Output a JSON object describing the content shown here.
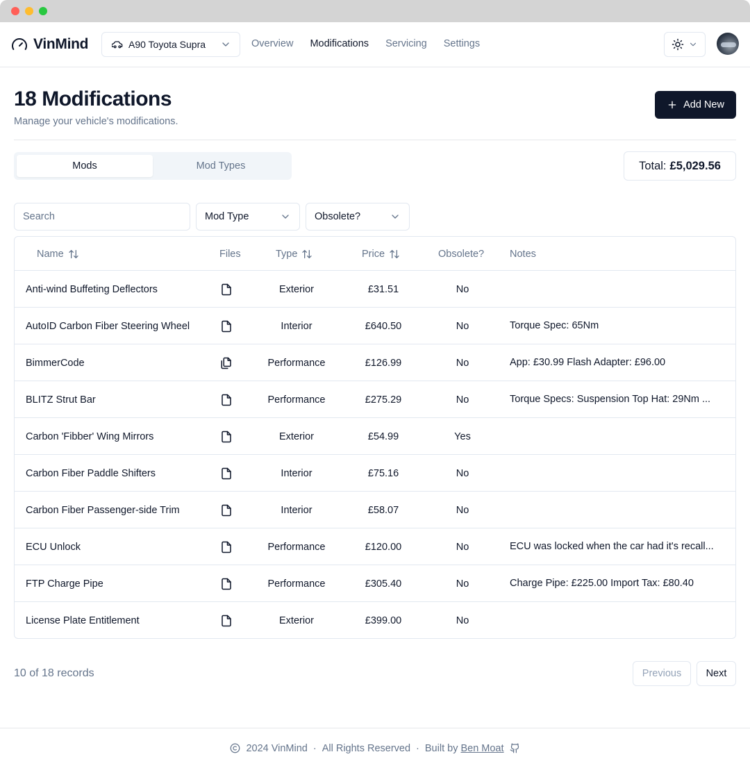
{
  "app": {
    "brand": "VinMind",
    "vehicle": "A90 Toyota Supra",
    "nav": [
      {
        "label": "Overview",
        "active": false
      },
      {
        "label": "Modifications",
        "active": true
      },
      {
        "label": "Servicing",
        "active": false
      },
      {
        "label": "Settings",
        "active": false
      }
    ]
  },
  "page": {
    "title": "18 Modifications",
    "subtitle": "Manage your vehicle's modifications.",
    "add_button": "Add New",
    "tabs": [
      {
        "label": "Mods",
        "active": true
      },
      {
        "label": "Mod Types",
        "active": false
      }
    ],
    "total_label": "Total:",
    "total_value": "£5,029.56"
  },
  "filters": {
    "search_placeholder": "Search",
    "mod_type": "Mod Type",
    "obsolete": "Obsolete?"
  },
  "table": {
    "headers": {
      "name": "Name",
      "files": "Files",
      "type": "Type",
      "price": "Price",
      "obsolete": "Obsolete?",
      "notes": "Notes"
    },
    "rows": [
      {
        "name": "Anti-wind Buffeting Deflectors",
        "files_icon": "file-icon",
        "type": "Exterior",
        "price": "£31.51",
        "obsolete": "No",
        "notes": ""
      },
      {
        "name": "AutoID Carbon Fiber Steering Wheel",
        "files_icon": "file-icon",
        "type": "Interior",
        "price": "£640.50",
        "obsolete": "No",
        "notes": "Torque Spec: 65Nm"
      },
      {
        "name": "BimmerCode",
        "files_icon": "files-icon",
        "type": "Performance",
        "price": "£126.99",
        "obsolete": "No",
        "notes": "App: £30.99 Flash Adapter: £96.00"
      },
      {
        "name": "BLITZ Strut Bar",
        "files_icon": "file-icon",
        "type": "Performance",
        "price": "£275.29",
        "obsolete": "No",
        "notes": "Torque Specs: Suspension Top Hat: 29Nm ..."
      },
      {
        "name": "Carbon 'Fibber' Wing Mirrors",
        "files_icon": "file-icon",
        "type": "Exterior",
        "price": "£54.99",
        "obsolete": "Yes",
        "notes": ""
      },
      {
        "name": "Carbon Fiber Paddle Shifters",
        "files_icon": "file-icon",
        "type": "Interior",
        "price": "£75.16",
        "obsolete": "No",
        "notes": ""
      },
      {
        "name": "Carbon Fiber Passenger-side Trim",
        "files_icon": "file-icon",
        "type": "Interior",
        "price": "£58.07",
        "obsolete": "No",
        "notes": ""
      },
      {
        "name": "ECU Unlock",
        "files_icon": "file-icon",
        "type": "Performance",
        "price": "£120.00",
        "obsolete": "No",
        "notes": "ECU was locked when the car had it's recall..."
      },
      {
        "name": "FTP Charge Pipe",
        "files_icon": "file-icon",
        "type": "Performance",
        "price": "£305.40",
        "obsolete": "No",
        "notes": "Charge Pipe: £225.00 Import Tax: £80.40"
      },
      {
        "name": "License Plate Entitlement",
        "files_icon": "file-icon",
        "type": "Exterior",
        "price": "£399.00",
        "obsolete": "No",
        "notes": ""
      }
    ]
  },
  "pagination": {
    "records": "10 of 18 records",
    "previous": "Previous",
    "next": "Next"
  },
  "footer": {
    "copyright": "2024 VinMind",
    "rights": "All Rights Reserved",
    "built_by": "Built by",
    "author": "Ben Moat",
    "separator": "·"
  },
  "colors": {
    "primary": "#0f172a",
    "muted": "#64748b",
    "border": "#e2e8f0"
  }
}
